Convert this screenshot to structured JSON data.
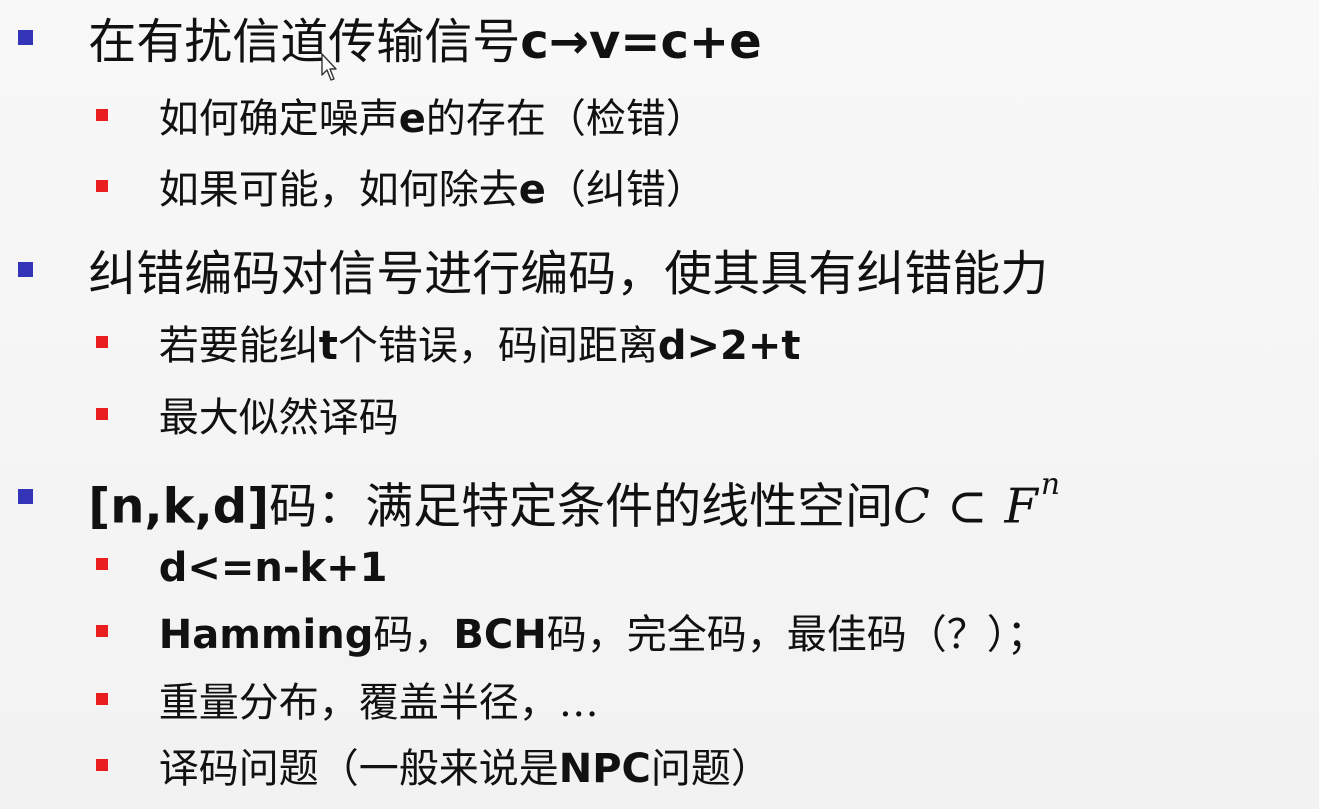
{
  "slide": {
    "items": [
      {
        "bullet": "square",
        "color": "#3434b8",
        "text_cn": "在有扰信道传输信号",
        "formula": "c→v=c+e"
      },
      {
        "bullet": "square",
        "color": "#ea1e1e",
        "text_cn_1": "如何确定噪声",
        "formula": "e",
        "text_cn_2": "的存在（检错）"
      },
      {
        "bullet": "square",
        "color": "#ea1e1e",
        "text_cn_1": "如果可能，如何除去",
        "formula": "e",
        "text_cn_2": "（纠错）"
      },
      {
        "bullet": "square",
        "color": "#3434b8",
        "text": "纠错编码对信号进行编码，使其具有纠错能力"
      },
      {
        "bullet": "square",
        "color": "#ea1e1e",
        "text_cn_1": "若要能纠",
        "formula_1": "t",
        "text_cn_2": "个错误，码间距离",
        "formula_2": "d>2+t"
      },
      {
        "bullet": "square",
        "color": "#ea1e1e",
        "text": "最大似然译码"
      },
      {
        "bullet": "square",
        "color": "#3434b8",
        "prefix": "[n,k,d]",
        "text_cn": "码：满足特定条件的线性空间",
        "math_main": "C ⊂ F",
        "math_sup": "n"
      },
      {
        "bullet": "square",
        "color": "#ea1e1e",
        "text": "d<=n-k+1"
      },
      {
        "bullet": "square",
        "color": "#ea1e1e",
        "latin_1": "Hamming",
        "text_cn_1": "码，",
        "latin_2": "BCH",
        "text_cn_2": "码，完全码，最佳码（？）；"
      },
      {
        "bullet": "square",
        "color": "#ea1e1e",
        "text": "重量分布，覆盖半径，…"
      },
      {
        "bullet": "square",
        "color": "#ea1e1e",
        "text_cn_1": "译码问题（一般来说是",
        "latin": "NPC",
        "text_cn_2": "问题）"
      }
    ]
  },
  "icons": {
    "mouse_cursor": "mouse-cursor-icon"
  }
}
